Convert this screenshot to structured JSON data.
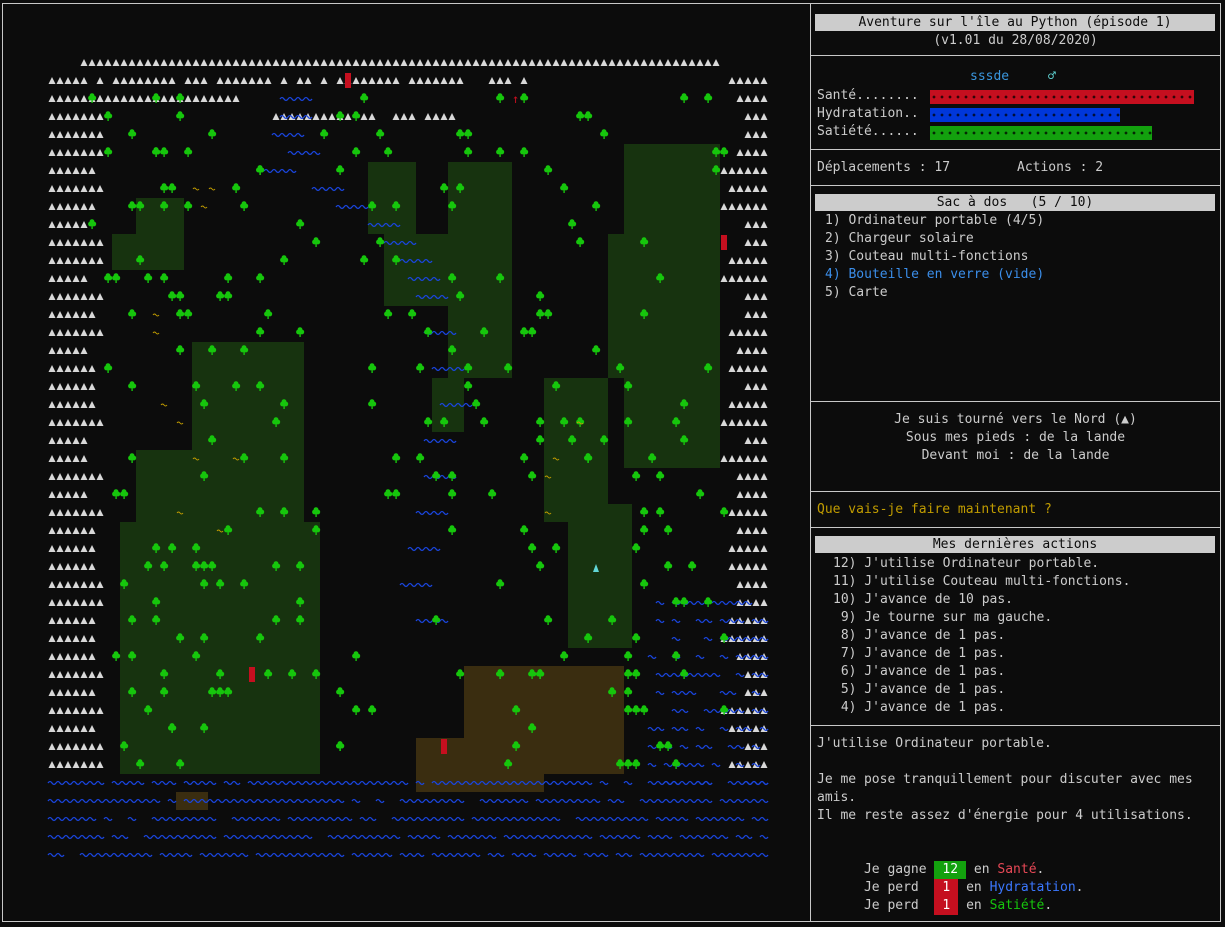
{
  "title": {
    "line1": "Aventure sur l'île au Python (épisode 1)",
    "line2": "(v1.01 du 28/08/2020)"
  },
  "player": {
    "name": "sssde",
    "gender_symbol": "♂"
  },
  "stats": [
    {
      "label": "Santé........",
      "level": 1.0,
      "color": "#c50f1f"
    },
    {
      "label": "Hydratation..",
      "level": 0.72,
      "color": "#0037da"
    },
    {
      "label": "Satiété......",
      "level": 0.84,
      "color": "#13a10e"
    }
  ],
  "counters": {
    "moves_text": "Déplacements : 17",
    "actions_text": "Actions : 2"
  },
  "backpack": {
    "title": "Sac à dos   (5 / 10)",
    "items": [
      {
        "text": "1) Ordinateur portable (4/5)",
        "color": "#cccccc"
      },
      {
        "text": "2) Chargeur solaire",
        "color": "#cccccc"
      },
      {
        "text": "3) Couteau multi-fonctions",
        "color": "#cccccc"
      },
      {
        "text": "4) Bouteille en verre (vide)",
        "color": "#3b8eea"
      },
      {
        "text": "5) Carte",
        "color": "#cccccc"
      }
    ]
  },
  "orientation": {
    "facing": "Je suis tourné vers le Nord (▲)",
    "under": "Sous mes pieds : de la lande",
    "front": "Devant moi : de la lande"
  },
  "prompt": {
    "text": "Que vais-je faire maintenant ?",
    "color": "#c19c00"
  },
  "history": {
    "title": "Mes dernières actions",
    "items": [
      "12) J'utilise Ordinateur portable.",
      "11) J'utilise Couteau multi-fonctions.",
      "10) J'avance de 10 pas.",
      " 9) Je tourne sur ma gauche.",
      " 8) J'avance de 1 pas.",
      " 7) J'avance de 1 pas.",
      " 6) J'avance de 1 pas.",
      " 5) J'avance de 1 pas.",
      " 4) J'avance de 1 pas."
    ]
  },
  "message": {
    "line1": "J'utilise Ordinateur portable.",
    "line2": "Je me pose tranquillement pour discuter avec mes",
    "line3": "amis.",
    "line4": "Il me reste assez d'énergie pour 4 utilisations.",
    "effects": [
      {
        "verb": "Je gagne",
        "value": "12",
        "chip_color": "#13a10e",
        "prep": "en",
        "stat": "Santé",
        "stat_color": "#e74856"
      },
      {
        "verb": "Je perd",
        "value": "1",
        "chip_color": "#c50f1f",
        "prep": "en",
        "stat": "Hydratation",
        "stat_color": "#3b78ff"
      },
      {
        "verb": "Je perd",
        "value": "1",
        "chip_color": "#c50f1f",
        "prep": "en",
        "stat": "Satiété",
        "stat_color": "#16c60c"
      }
    ]
  },
  "colors": {
    "mountain": "#d8d8d8",
    "water": "#1a46e0",
    "tree": "#16c60c",
    "forest_bg": "#17330f",
    "sand": "#3a2d10",
    "river_squiggle": "#c19c00",
    "marker": "#c50f1f",
    "player_icon": "#61d6d6"
  },
  "map": {
    "legend_icons": [
      "mountain-icon",
      "water-icon",
      "tree-icon",
      "forest-icon",
      "sand-icon",
      "marker-icon",
      "player-icon",
      "arrow-icon"
    ]
  }
}
